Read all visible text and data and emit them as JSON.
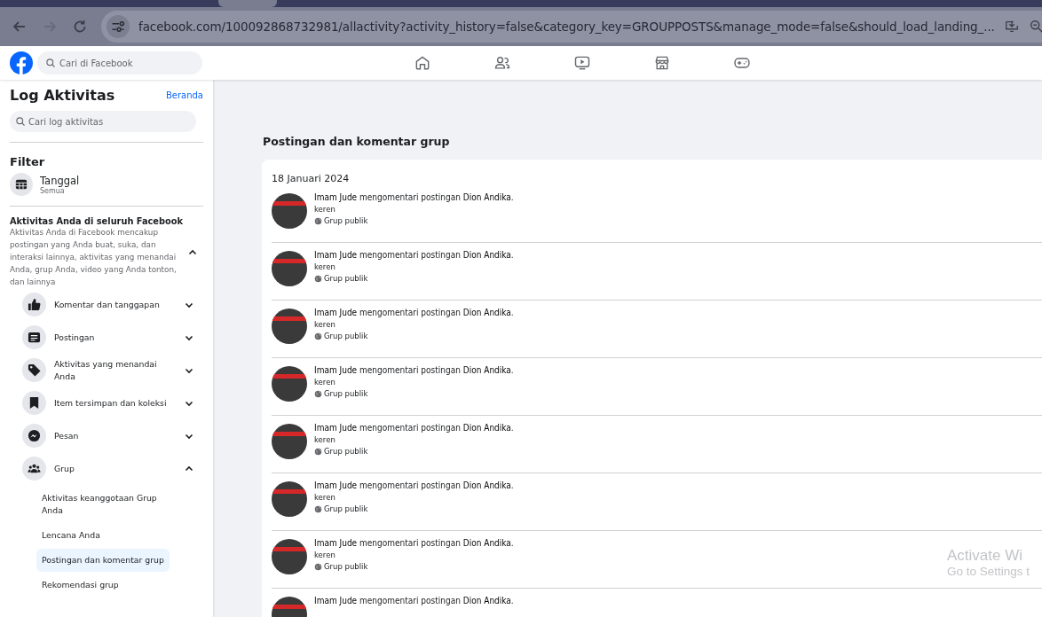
{
  "browser": {
    "url": "facebook.com/100092868732981/allactivity?activity_history=false&category_key=GROUPPOSTS&manage_mode=false&should_load_landing_..."
  },
  "header": {
    "search_placeholder": "Cari di Facebook"
  },
  "sidebar": {
    "title": "Log Aktivitas",
    "home_link": "Beranda",
    "search_placeholder": "Cari log aktivitas",
    "filter_heading": "Filter",
    "filter": {
      "label": "Tanggal",
      "value": "Semua"
    },
    "section": {
      "title": "Aktivitas Anda di seluruh Facebook",
      "description": "Aktivitas Anda di Facebook mencakup postingan yang Anda buat, suka, dan interaksi lainnya, aktivitas yang menandai Anda, grup Anda, video yang Anda tonton, dan lainnya",
      "expanded": true
    },
    "categories": [
      {
        "label": "Komentar dan tanggapan",
        "expanded": false
      },
      {
        "label": "Postingan",
        "expanded": false
      },
      {
        "label": "Aktivitas yang menandai Anda",
        "expanded": false
      },
      {
        "label": "Item tersimpan dan koleksi",
        "expanded": false
      },
      {
        "label": "Pesan",
        "expanded": false
      },
      {
        "label": "Grup",
        "expanded": true,
        "children": [
          {
            "label": "Aktivitas keanggotaan Grup Anda",
            "selected": false
          },
          {
            "label": "Lencana Anda",
            "selected": false
          },
          {
            "label": "Postingan dan komentar grup",
            "selected": true
          },
          {
            "label": "Rekomendasi grup",
            "selected": false
          }
        ]
      }
    ]
  },
  "main": {
    "heading": "Postingan dan komentar grup",
    "date": "18 Januari 2024",
    "activities": [
      {
        "text": "**Imam Jude** mengomentari postingan **Dion Andika**.",
        "comment": "keren",
        "audience": "Grup publik"
      },
      {
        "text": "**Imam Jude** mengomentari postingan **Dion Andika**.",
        "comment": "keren",
        "audience": "Grup publik"
      },
      {
        "text": "**Imam Jude** mengomentari postingan **Dion Andika**.",
        "comment": "keren",
        "audience": "Grup publik"
      },
      {
        "text": "**Imam Jude** mengomentari postingan **Dion Andika**.",
        "comment": "keren",
        "audience": "Grup publik"
      },
      {
        "text": "**Imam Jude** mengomentari postingan **Dion Andika**.",
        "comment": "keren",
        "audience": "Grup publik"
      },
      {
        "text": "**Imam Jude** mengomentari postingan **Dion Andika**.",
        "comment": "keren",
        "audience": "Grup publik"
      },
      {
        "text": "**Imam Jude** mengomentari postingan **Dion Andika**.",
        "comment": "keren",
        "audience": "Grup publik"
      },
      {
        "text": "**Imam Jude** mengomentari postingan **Dion Andika**."
      }
    ]
  },
  "os_notice": {
    "title": "Activate Wi",
    "subtitle": "Go to Settings t"
  }
}
